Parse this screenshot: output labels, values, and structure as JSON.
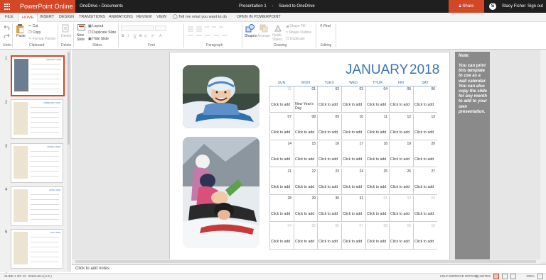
{
  "app": {
    "name": "PowerPoint Online",
    "breadcrumb": [
      "OneDrive",
      "Documents"
    ],
    "breadcrumb_sep": "›",
    "doc_title": "Presentation 1",
    "title_sep": "-",
    "save_status": "Saved to OneDrive",
    "share_label": "Share",
    "skype_glyph": "S",
    "user_name": "Stacy Fisher",
    "signout_label": "Sign out",
    "brand_color": "#d24726"
  },
  "tabs": {
    "file": "FILE",
    "home": "HOME",
    "insert": "INSERT",
    "design": "DESIGN",
    "transitions": "TRANSITIONS",
    "animations": "ANIMATIONS",
    "review": "REVIEW",
    "view": "VIEW",
    "tell_me": "Tell me what you want to do",
    "open_in": "OPEN IN POWERPOINT"
  },
  "ribbon": {
    "undo_label": "Undo",
    "paste": "Paste",
    "cut": "Cut",
    "copy": "Copy",
    "format_painter": "Format Painter",
    "clipboard": "Clipboard",
    "delete": "Delete",
    "delete_group": "Delete",
    "new_slide": "New Slide",
    "layout": "Layout",
    "duplicate_slide": "Duplicate Slide",
    "hide_slide": "Hide Slide",
    "slides": "Slides",
    "font": "Font",
    "paragraph": "Paragraph",
    "shapes": "Shapes",
    "arrange": "Arrange",
    "quick_styles": "Quick Styles",
    "shape_fill": "Shape Fill",
    "shape_outline": "Shape Outline",
    "duplicate": "Duplicate",
    "drawing": "Drawing",
    "find": "Find",
    "editing": "Editing",
    "font_buttons": [
      "B",
      "I",
      "U",
      "S",
      "x₂",
      "x²",
      "A"
    ]
  },
  "thumbnails": {
    "numbers": [
      "1",
      "2",
      "3",
      "4",
      "5",
      "6"
    ],
    "months": [
      "JANUARY 2018",
      "FEBRUARY 2018",
      "MARCH 2018",
      "APRIL 2018",
      "MAY 2018"
    ]
  },
  "calendar": {
    "month": "JANUARY",
    "year": "2018",
    "weekdays": [
      "SUN",
      "MON",
      "TUES",
      "WED",
      "THUR",
      "FRI",
      "SAT"
    ],
    "cells": [
      {
        "n": "31",
        "t": "Click to add",
        "o": true
      },
      {
        "n": "01",
        "t": "New Year's Day",
        "h": true
      },
      {
        "n": "02",
        "t": "Click to add"
      },
      {
        "n": "03",
        "t": "Click to add"
      },
      {
        "n": "04",
        "t": "Click to add"
      },
      {
        "n": "05",
        "t": "Click to add"
      },
      {
        "n": "06",
        "t": "Click to add"
      },
      {
        "n": "07",
        "t": "Click to add"
      },
      {
        "n": "08",
        "t": "Click to add"
      },
      {
        "n": "09",
        "t": "Click to add"
      },
      {
        "n": "10",
        "t": "Click to add"
      },
      {
        "n": "11",
        "t": "Click to add"
      },
      {
        "n": "12",
        "t": "Click to add"
      },
      {
        "n": "13",
        "t": "Click to add"
      },
      {
        "n": "14",
        "t": "Click to add"
      },
      {
        "n": "15",
        "t": "Click to add"
      },
      {
        "n": "16",
        "t": "Click to add"
      },
      {
        "n": "17",
        "t": "Click to add"
      },
      {
        "n": "18",
        "t": "Click to add"
      },
      {
        "n": "19",
        "t": "Click to add"
      },
      {
        "n": "20",
        "t": "Click to add"
      },
      {
        "n": "21",
        "t": "Click to add"
      },
      {
        "n": "22",
        "t": "Click to add"
      },
      {
        "n": "23",
        "t": "Click to add"
      },
      {
        "n": "24",
        "t": "Click to add"
      },
      {
        "n": "25",
        "t": "Click to add"
      },
      {
        "n": "26",
        "t": "Click to add"
      },
      {
        "n": "27",
        "t": "Click to add"
      },
      {
        "n": "28",
        "t": "Click to add"
      },
      {
        "n": "29",
        "t": "Click to add"
      },
      {
        "n": "30",
        "t": "Click to add"
      },
      {
        "n": "31",
        "t": "Click to add"
      },
      {
        "n": "01",
        "t": "Click to add",
        "o": true
      },
      {
        "n": "02",
        "t": "Click to add",
        "o": true
      },
      {
        "n": "03",
        "t": "Click to add",
        "o": true
      },
      {
        "n": "04",
        "t": "Click to add",
        "o": true
      },
      {
        "n": "05",
        "t": "Click to add",
        "o": true
      },
      {
        "n": "06",
        "t": "Click to add",
        "o": true
      },
      {
        "n": "07",
        "t": "Click to add",
        "o": true
      },
      {
        "n": "08",
        "t": "Click to add",
        "o": true
      },
      {
        "n": "09",
        "t": "Click to add",
        "o": true
      },
      {
        "n": "10",
        "t": "Click to add",
        "o": true
      }
    ],
    "accent": "#3a73b6"
  },
  "note": {
    "title": "Note:",
    "body": "You can print this template to use as a wall calendar. You can also copy the slide for any month to add to your own presentation."
  },
  "notes_placeholder": "Click to add notes",
  "status": {
    "slide": "SLIDE 1 OF 12",
    "language": "ENGLISH (U.S.)",
    "help": "HELP IMPROVE OFFICE",
    "notes": "NOTES",
    "zoom": "100%"
  }
}
